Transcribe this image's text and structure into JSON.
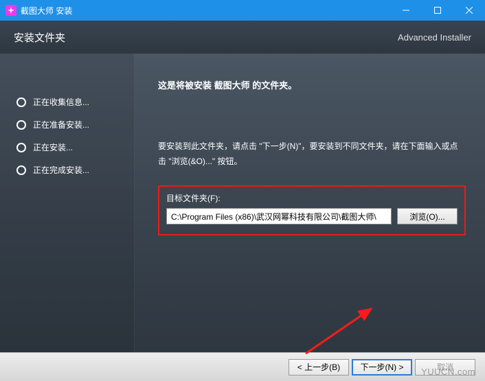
{
  "titlebar": {
    "title": "截图大师 安装"
  },
  "header": {
    "title": "安装文件夹",
    "brand": "Advanced Installer"
  },
  "sidebar": {
    "steps": [
      {
        "label": "正在收集信息..."
      },
      {
        "label": "正在准备安装..."
      },
      {
        "label": "正在安装..."
      },
      {
        "label": "正在完成安装..."
      }
    ]
  },
  "main": {
    "heading": "这是将被安装 截图大师 的文件夹。",
    "instruction": "要安装到此文件夹，请点击 \"下一步(N)\"，要安装到不同文件夹，请在下面输入或点击 \"浏览(&O)...\" 按钮。",
    "target_label": "目标文件夹(F):",
    "path_value": "C:\\Program Files (x86)\\武汉网幂科技有限公司\\截图大师\\",
    "browse_label": "浏览(O)..."
  },
  "footer": {
    "back_label": "< 上一步(B)",
    "next_label": "下一步(N) >",
    "cancel_label": "取消"
  },
  "watermark": "YUUCN.com"
}
